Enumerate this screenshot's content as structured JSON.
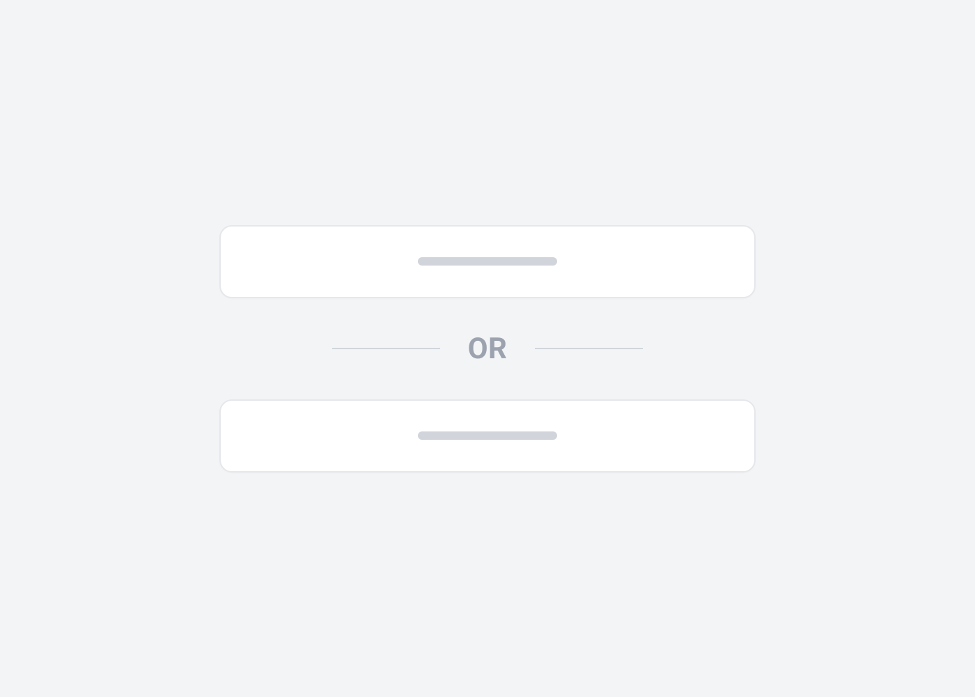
{
  "divider": {
    "label": "OR"
  },
  "options": {
    "top_label": "",
    "bottom_label": ""
  }
}
